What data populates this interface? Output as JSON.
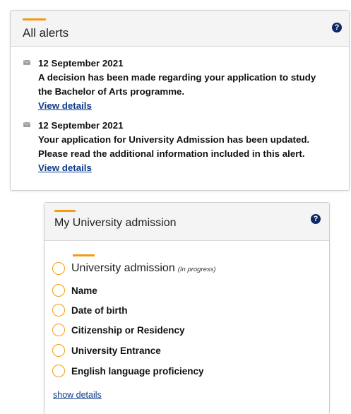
{
  "alerts_panel": {
    "title": "All alerts",
    "help_icon": "?",
    "alerts": [
      {
        "date": "12 September 2021",
        "lines": [
          "A decision has been made regarding your application to study",
          "the Bachelor of Arts programme."
        ],
        "link": "View details"
      },
      {
        "date": "12 September 2021",
        "lines": [
          "Your application for University Admission has been updated.",
          "Please read the additional information included in this alert."
        ],
        "link": "View details"
      }
    ]
  },
  "admission_panel": {
    "title": "My University admission",
    "help_icon": "?",
    "main_step": {
      "label": "University admission",
      "status": "(In progress)"
    },
    "steps": [
      "Name",
      "Date of birth",
      "Citizenship or Residency",
      "University Entrance",
      "English language proficiency"
    ],
    "show_details": "show details"
  },
  "colors": {
    "accent": "#f39c12",
    "link": "#0d3a8a",
    "help_icon": "#0d2a66"
  },
  "icons": {
    "alert_item": "envelope-icon",
    "step_status": "circle-outline-icon",
    "help": "question-circle-icon"
  }
}
